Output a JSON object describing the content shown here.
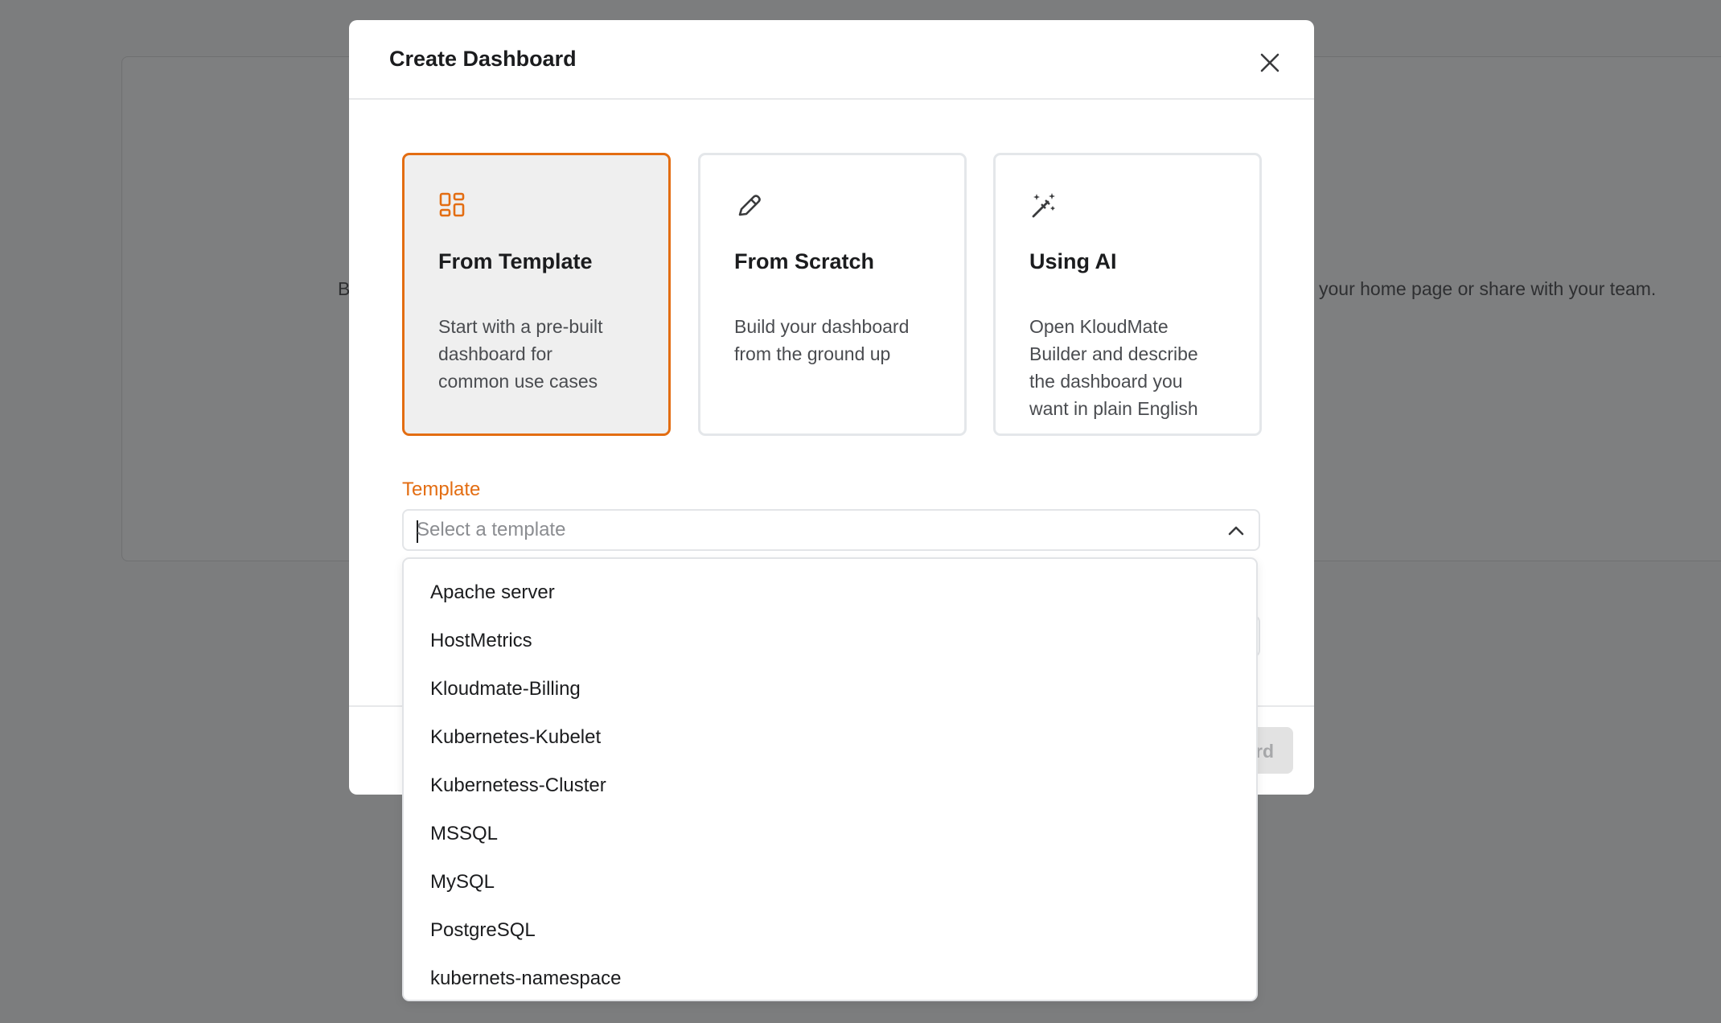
{
  "background": {
    "text_left": "B",
    "text_right": "your home page or share with your team."
  },
  "modal": {
    "title": "Create Dashboard",
    "close_icon": "close-icon",
    "options": [
      {
        "title": "From Template",
        "icon": "template-grid-icon",
        "desc_lines": [
          "Start with a pre-built",
          "dashboard for",
          "common use cases"
        ],
        "selected": true
      },
      {
        "title": "From Scratch",
        "icon": "pencil-icon",
        "desc_lines": [
          "Build your dashboard",
          "from the ground up"
        ],
        "selected": false
      },
      {
        "title": "Using AI",
        "icon": "magic-wand-icon",
        "desc_lines": [
          "Open KloudMate",
          "Builder and describe",
          "the dashboard you",
          "want in plain English"
        ],
        "selected": false
      }
    ],
    "template_field": {
      "label": "Template",
      "placeholder": "Select a template",
      "value": "",
      "chevron_icon": "chevron-up-icon"
    },
    "create_button_label": "rd"
  },
  "dropdown": {
    "items": [
      "Apache server",
      "HostMetrics",
      "Kloudmate-Billing",
      "Kubernetes-Kubelet",
      "Kubernetess-Cluster",
      "MSSQL",
      "MySQL",
      "PostgreSQL",
      "kubernets-namespace"
    ]
  },
  "colors": {
    "accent": "#e36d12",
    "overlay": "#7c7d7e",
    "text_primary": "#1b1c1e",
    "text_secondary": "#4a4c50"
  }
}
